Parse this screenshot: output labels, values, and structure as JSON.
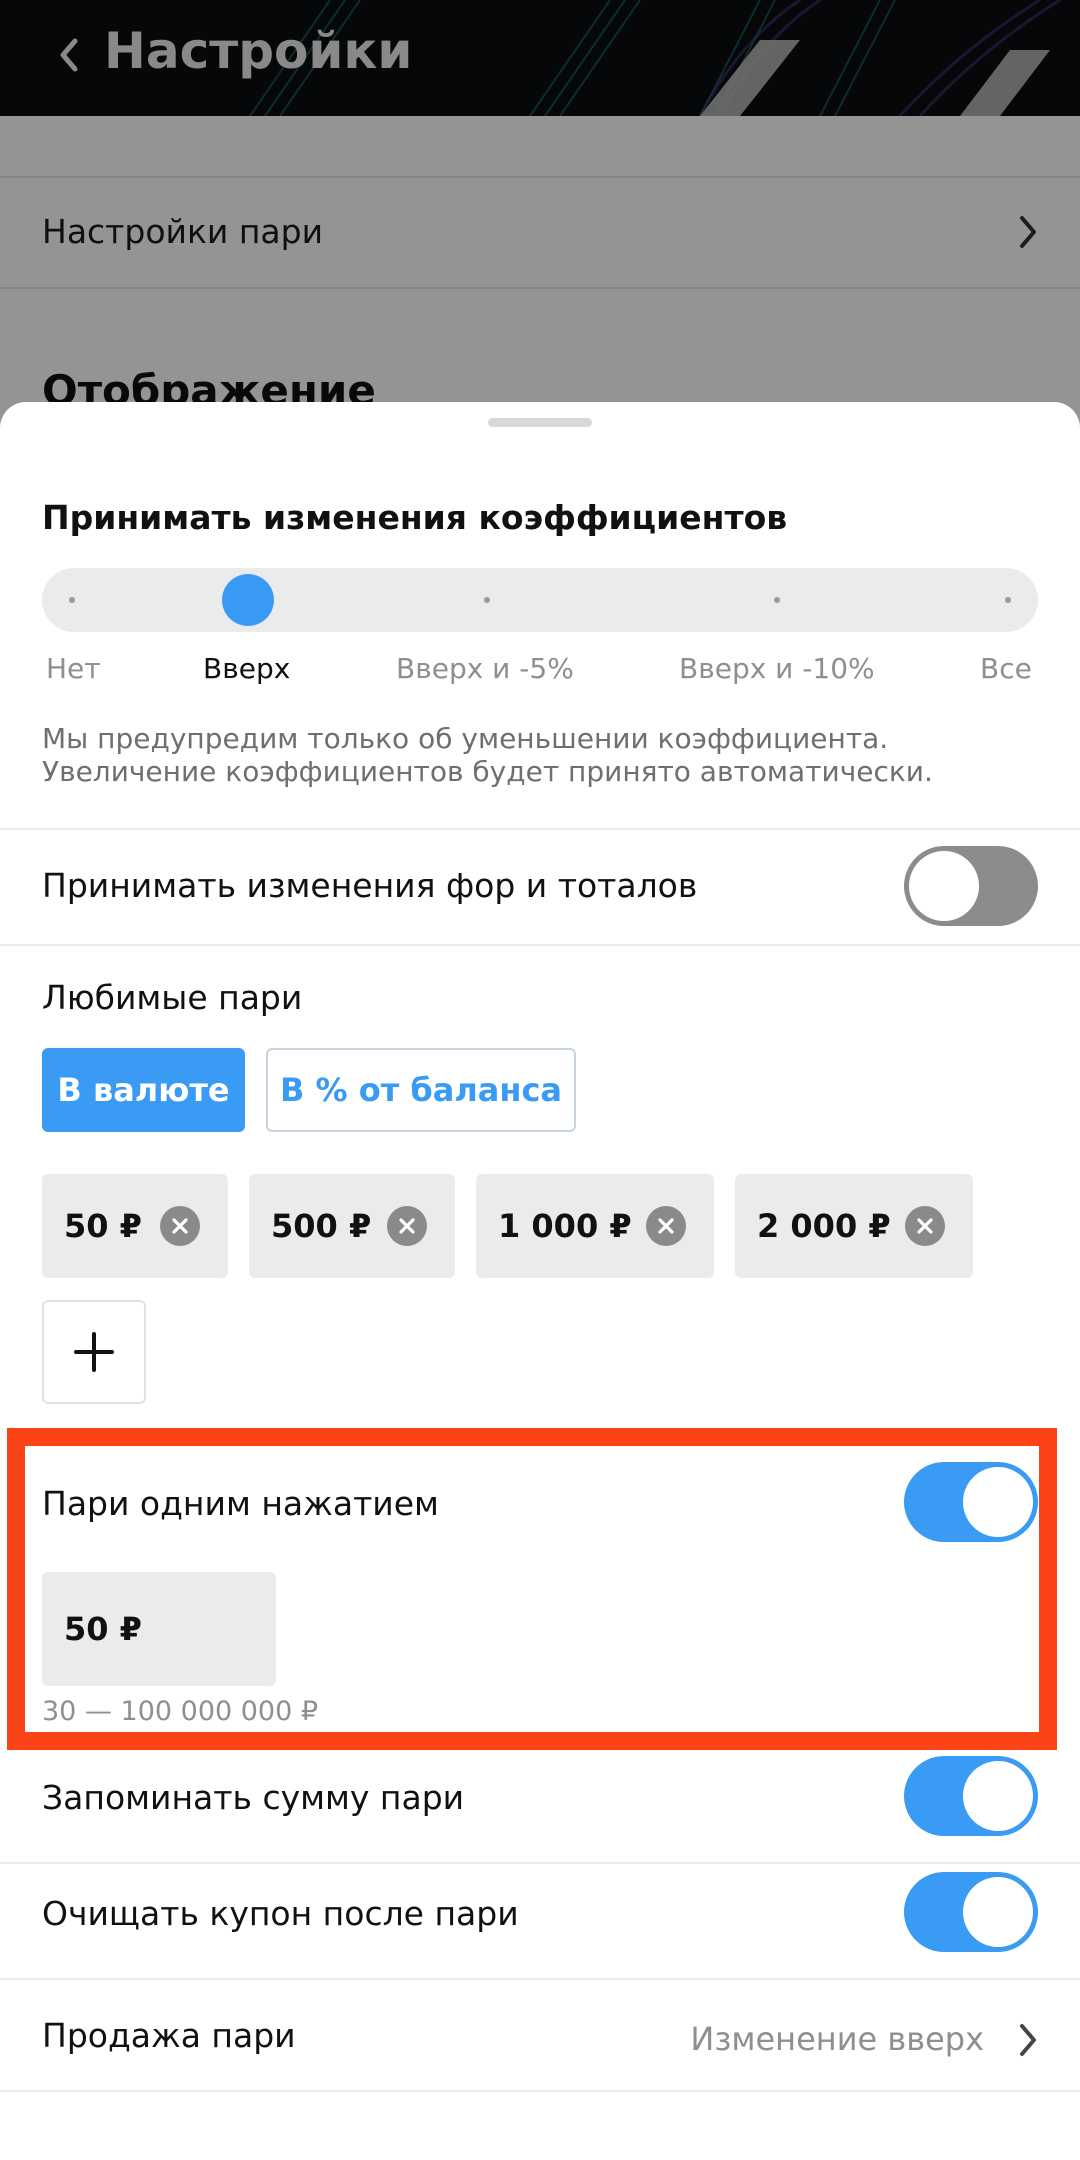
{
  "header": {
    "title": "Настройки"
  },
  "background": {
    "row_label": "Настройки пари",
    "section_title": "Отображение"
  },
  "sheet": {
    "odds_section": {
      "title": "Принимать изменения коэффициентов",
      "options": [
        "Нет",
        "Вверх",
        "Вверх и -5%",
        "Вверх и -10%",
        "Все"
      ],
      "selected": "Вверх",
      "hint": "Мы предупредим только об уменьшении коэффициента. Увеличение коэффициентов будет принято автоматически."
    },
    "handicap_toggle": {
      "label": "Принимать изменения фор и тоталов",
      "on": false
    },
    "favorite_bets": {
      "title": "Любимые пари",
      "tabs": [
        "В валюте",
        "В % от баланса"
      ],
      "active_tab": "В валюте",
      "amounts": [
        "50 ₽",
        "500 ₽",
        "1 000 ₽",
        "2 000 ₽"
      ]
    },
    "one_click": {
      "label": "Пари одним нажатием",
      "on": true,
      "amount": "50 ₽",
      "range": "30 — 100 000 000 ₽"
    },
    "remember_amount": {
      "label": "Запоминать сумму пари",
      "on": true
    },
    "clear_coupon": {
      "label": "Очищать купон после пари",
      "on": true
    },
    "sale": {
      "label": "Продажа пари",
      "value": "Изменение вверх"
    }
  },
  "colors": {
    "accent": "#3a9bf5",
    "highlight": "#fa4418",
    "toggle_off": "#8c8c8c"
  }
}
